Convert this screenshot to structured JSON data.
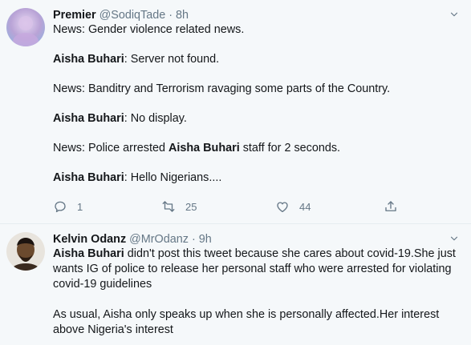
{
  "tweets": [
    {
      "name": "Premier",
      "handle": "@SodiqTade",
      "separator": "·",
      "time": "8h",
      "lines": [
        {
          "pre": "News: Gender violence related news.",
          "bold": "",
          "post": ""
        },
        {
          "pre": "",
          "bold": "Aisha Buhari",
          "post": ": Server not found."
        },
        {
          "pre": "News: Banditry and Terrorism ravaging some parts of the Country.",
          "bold": "",
          "post": ""
        },
        {
          "pre": "",
          "bold": "Aisha Buhari",
          "post": ": No display."
        },
        {
          "pre": "News: Police arrested ",
          "bold": "Aisha Buhari",
          "post": " staff for 2 seconds."
        },
        {
          "pre": "",
          "bold": "Aisha Buhari",
          "post": ": Hello Nigerians...."
        }
      ],
      "replies": "1",
      "retweets": "25",
      "likes": "44",
      "avatar_color": "#b9a3d6"
    },
    {
      "name": "Kelvin Odanz",
      "handle": "@MrOdanz",
      "separator": "·",
      "time": "9h",
      "p1_bold": "Aisha Buhari",
      "p1_rest": " didn't post this tweet because she cares about covid-19.She just wants IG of police to release her personal staff who were arrested for violating covid-19 guidelines",
      "p2": "As usual, Aisha only speaks up when she is personally affected.Her interest above Nigeria's interest",
      "avatar_color": "#6b4a2e"
    }
  ],
  "colors": {
    "text": "#14171a",
    "secondary": "#657786",
    "background": "#f5f8fa"
  },
  "icons": [
    "reply-icon",
    "retweet-icon",
    "like-icon",
    "share-icon",
    "chevron-down-icon"
  ]
}
